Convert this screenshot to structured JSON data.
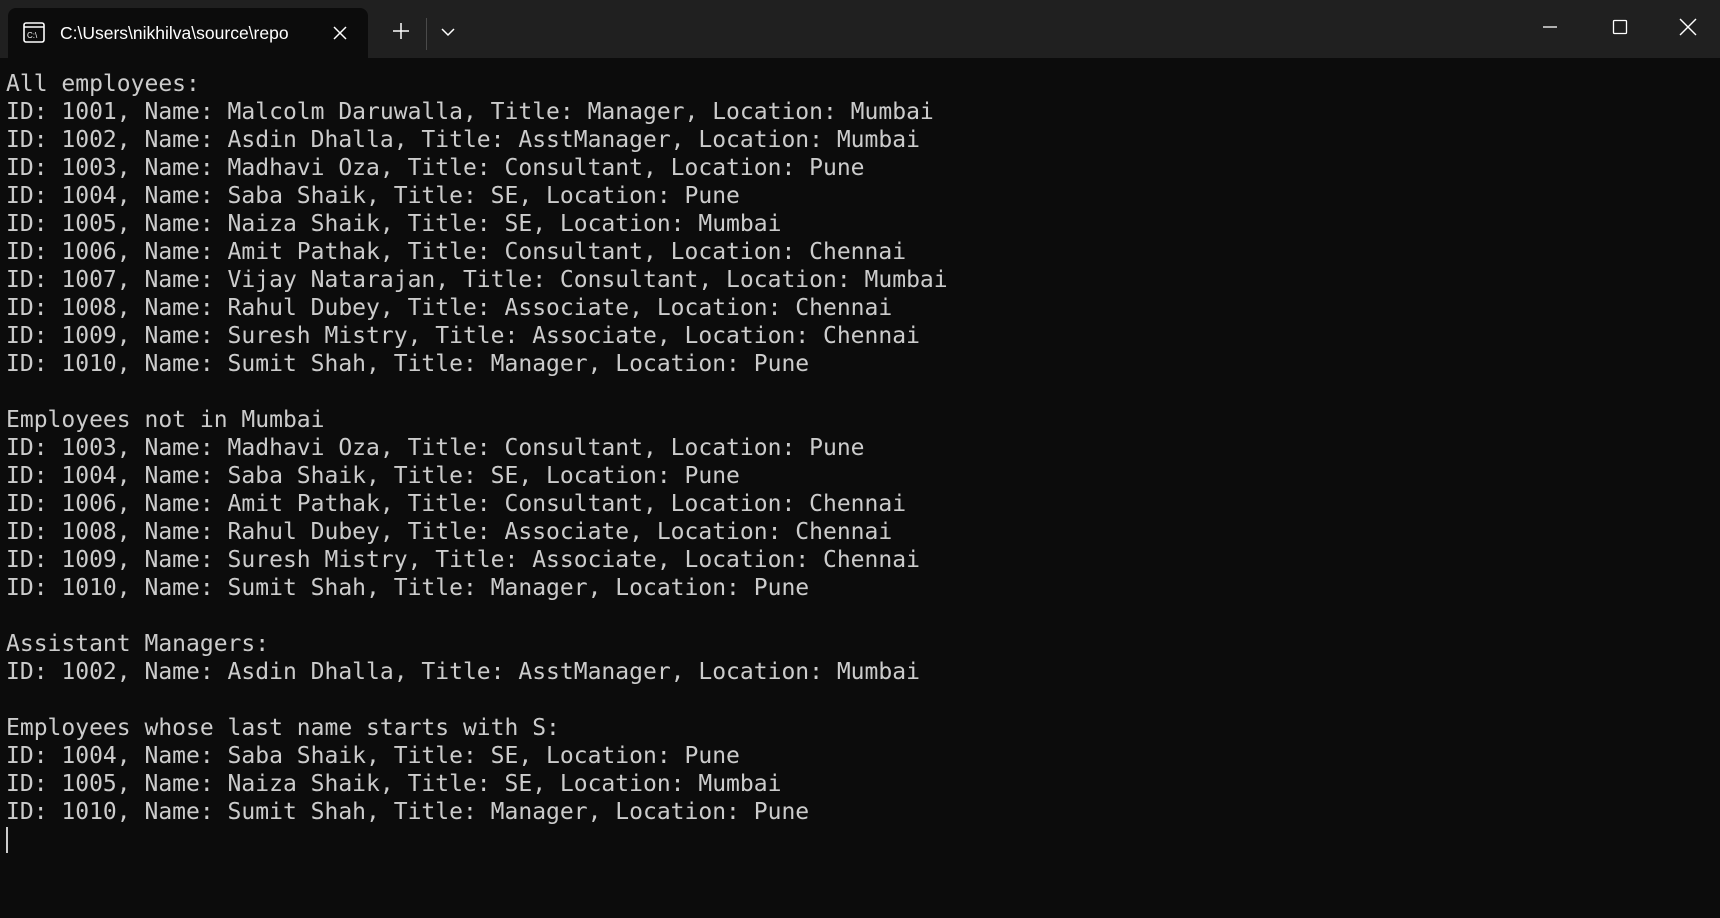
{
  "window": {
    "tab_title": "C:\\Users\\nikhilva\\source\\repo",
    "icons": {
      "tab": "terminal-icon",
      "close_tab": "close-icon",
      "new_tab": "plus-icon",
      "dropdown": "chevron-down-icon",
      "minimize": "minimize-icon",
      "maximize": "maximize-icon",
      "close": "close-icon"
    },
    "colors": {
      "background": "#0c0c0c",
      "titlebar": "#202020",
      "text": "#cccccc"
    }
  },
  "console": {
    "lines": [
      "All employees:",
      "ID: 1001, Name: Malcolm Daruwalla, Title: Manager, Location: Mumbai",
      "ID: 1002, Name: Asdin Dhalla, Title: AsstManager, Location: Mumbai",
      "ID: 1003, Name: Madhavi Oza, Title: Consultant, Location: Pune",
      "ID: 1004, Name: Saba Shaik, Title: SE, Location: Pune",
      "ID: 1005, Name: Naiza Shaik, Title: SE, Location: Mumbai",
      "ID: 1006, Name: Amit Pathak, Title: Consultant, Location: Chennai",
      "ID: 1007, Name: Vijay Natarajan, Title: Consultant, Location: Mumbai",
      "ID: 1008, Name: Rahul Dubey, Title: Associate, Location: Chennai",
      "ID: 1009, Name: Suresh Mistry, Title: Associate, Location: Chennai",
      "ID: 1010, Name: Sumit Shah, Title: Manager, Location: Pune",
      "",
      "Employees not in Mumbai",
      "ID: 1003, Name: Madhavi Oza, Title: Consultant, Location: Pune",
      "ID: 1004, Name: Saba Shaik, Title: SE, Location: Pune",
      "ID: 1006, Name: Amit Pathak, Title: Consultant, Location: Chennai",
      "ID: 1008, Name: Rahul Dubey, Title: Associate, Location: Chennai",
      "ID: 1009, Name: Suresh Mistry, Title: Associate, Location: Chennai",
      "ID: 1010, Name: Sumit Shah, Title: Manager, Location: Pune",
      "",
      "Assistant Managers:",
      "ID: 1002, Name: Asdin Dhalla, Title: AsstManager, Location: Mumbai",
      "",
      "Employees whose last name starts with S:",
      "ID: 1004, Name: Saba Shaik, Title: SE, Location: Pune",
      "ID: 1005, Name: Naiza Shaik, Title: SE, Location: Mumbai",
      "ID: 1010, Name: Sumit Shah, Title: Manager, Location: Pune"
    ]
  }
}
